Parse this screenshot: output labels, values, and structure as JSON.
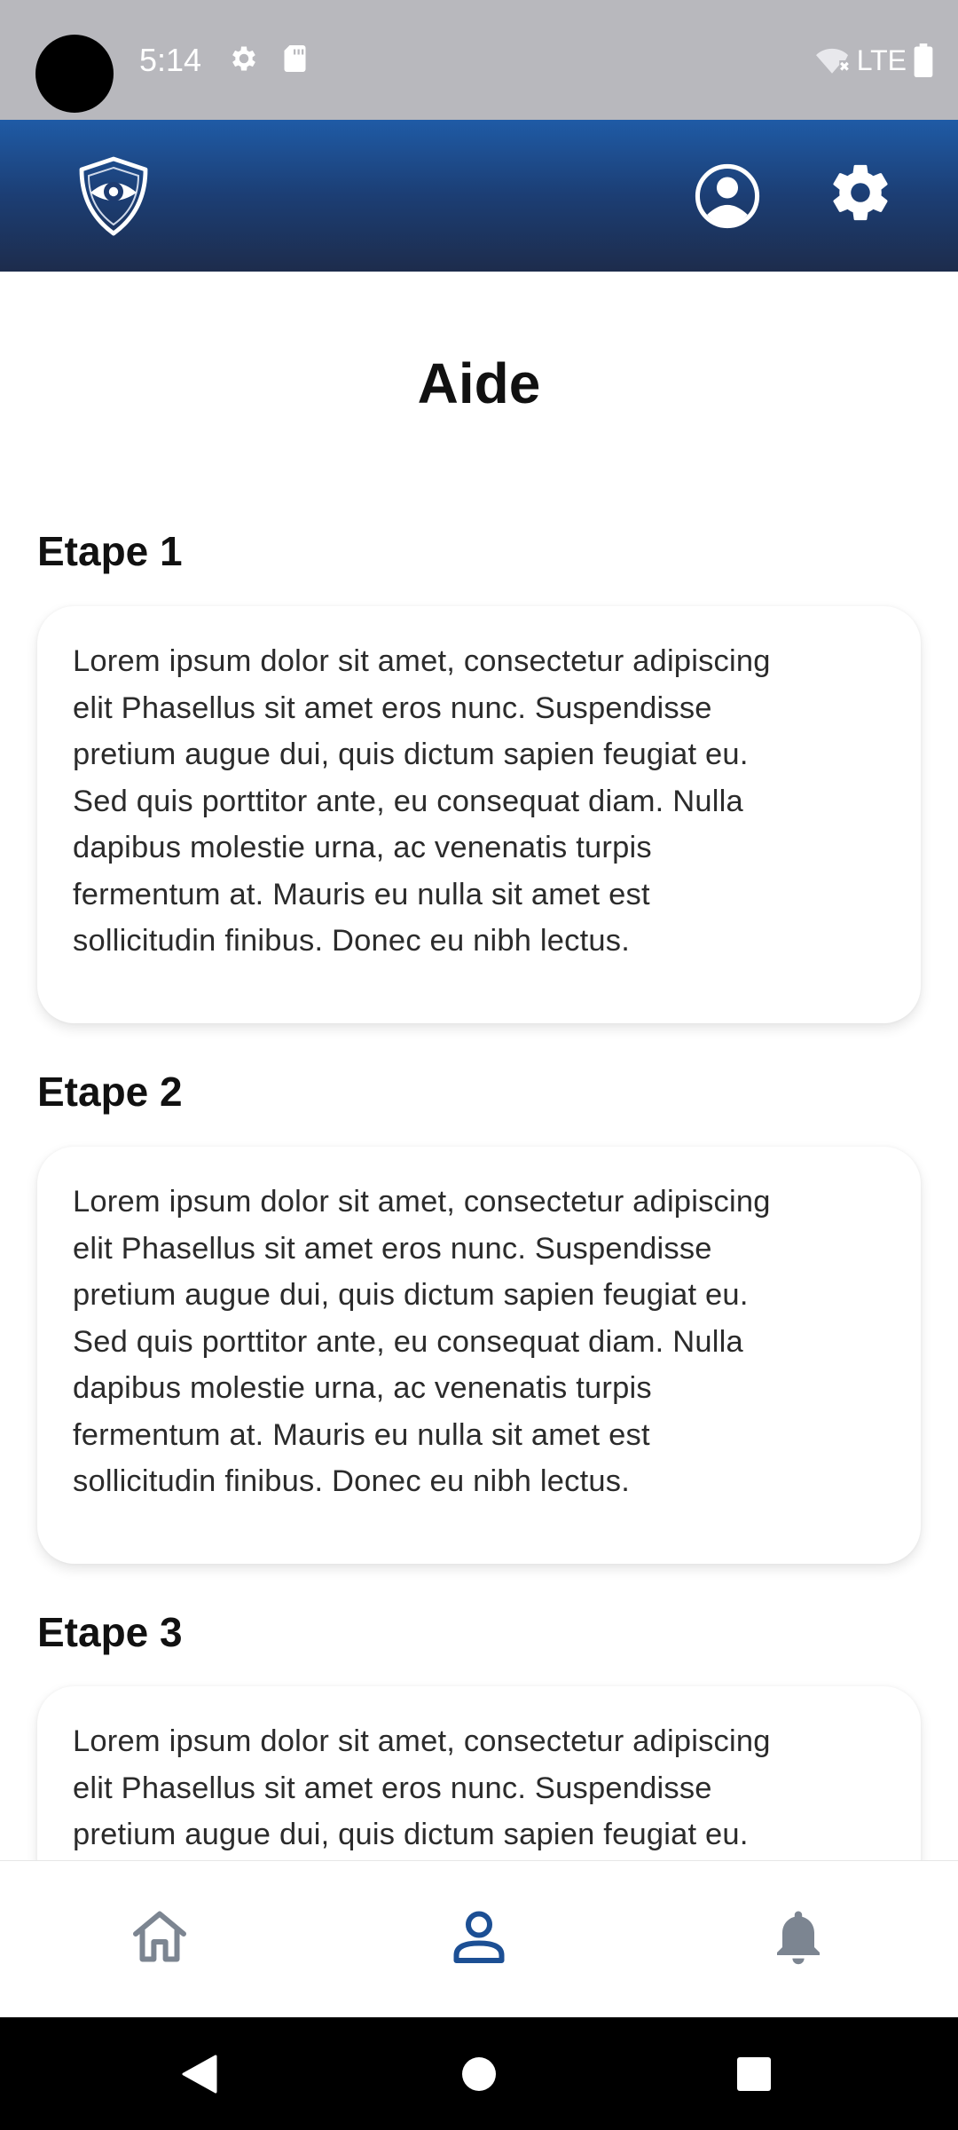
{
  "status_bar": {
    "time": "5:14",
    "network": "LTE"
  },
  "page": {
    "title": "Aide"
  },
  "steps": [
    {
      "title": "Etape 1",
      "text": "Lorem ipsum dolor sit amet, consectetur adipiscing\nelit Phasellus sit amet eros nunc. Suspendisse\npretium augue  dui, quis dictum sapien feugiat eu.\nSed quis porttitor ante, eu  consequat diam. Nulla\ndapibus molestie urna, ac venenatis turpis\nfermentum at. Mauris eu nulla sit amet est\nsollicitudin finibus. Donec  eu nibh lectus."
    },
    {
      "title": "Etape 2",
      "text": "Lorem ipsum dolor sit amet, consectetur adipiscing\nelit Phasellus sit amet eros nunc. Suspendisse\npretium augue  dui, quis dictum sapien feugiat eu.\nSed quis porttitor ante, eu  consequat diam. Nulla\ndapibus molestie urna, ac venenatis turpis\nfermentum at. Mauris eu nulla sit amet est\nsollicitudin finibus. Donec  eu nibh lectus."
    },
    {
      "title": "Etape 3",
      "text": "Lorem ipsum dolor sit amet, consectetur adipiscing\nelit Phasellus sit amet eros nunc. Suspendisse\npretium augue  dui, quis dictum sapien feugiat eu."
    }
  ],
  "colors": {
    "header_top": "#1f5ba6",
    "header_bottom": "#1d2c4c",
    "nav_active": "#1c4f94",
    "nav_inactive": "#7c8591"
  },
  "icons": {
    "logo": "shield-eye-icon",
    "header_profile": "user-circle-icon",
    "header_settings": "gear-icon",
    "nav_home": "home-icon",
    "nav_profile": "user-icon",
    "nav_notifications": "bell-icon"
  },
  "bottom_nav": {
    "active": "profile"
  }
}
